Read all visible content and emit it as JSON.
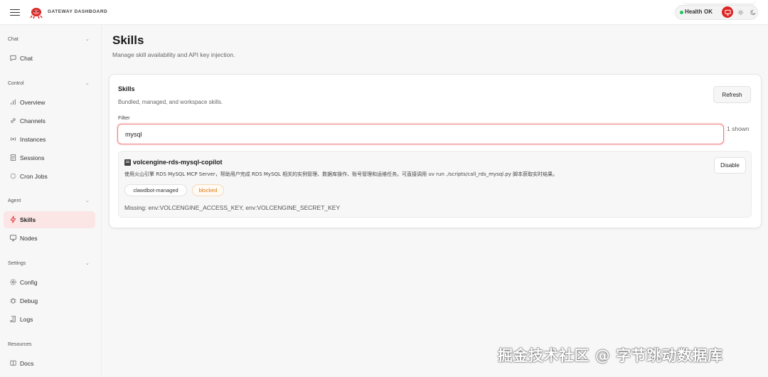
{
  "header": {
    "brand": "GATEWAY DASHBOARD",
    "health_label": "Health",
    "health_value": "OK",
    "health_color": "#22c55e",
    "theme_active_color": "#dc2626"
  },
  "sidebar": {
    "sections": [
      {
        "title": "Chat",
        "items": [
          {
            "label": "Chat",
            "icon": "message-icon"
          }
        ]
      },
      {
        "title": "Control",
        "items": [
          {
            "label": "Overview",
            "icon": "bar-chart-icon"
          },
          {
            "label": "Channels",
            "icon": "link-icon"
          },
          {
            "label": "Instances",
            "icon": "radio-icon"
          },
          {
            "label": "Sessions",
            "icon": "document-icon"
          },
          {
            "label": "Cron Jobs",
            "icon": "loader-icon"
          }
        ]
      },
      {
        "title": "Agent",
        "items": [
          {
            "label": "Skills",
            "icon": "lightning-icon",
            "active": true
          },
          {
            "label": "Nodes",
            "icon": "monitor-icon"
          }
        ]
      },
      {
        "title": "Settings",
        "items": [
          {
            "label": "Config",
            "icon": "gear-icon"
          },
          {
            "label": "Debug",
            "icon": "bug-icon"
          },
          {
            "label": "Logs",
            "icon": "scroll-icon"
          }
        ]
      },
      {
        "title": "Resources",
        "items": [
          {
            "label": "Docs",
            "icon": "book-icon"
          }
        ]
      }
    ]
  },
  "main": {
    "title": "Skills",
    "subtitle": "Manage skill availability and API key injection.",
    "card": {
      "title": "Skills",
      "subtitle": "Bundled, managed, and workspace skills.",
      "refresh_label": "Refresh",
      "filter_label": "Filter",
      "filter_value": "mysql",
      "shown_count": "1 shown",
      "skill": {
        "name": "volcengine-rds-mysql-copilot",
        "description": "使用火山引擎 RDS MySQL MCP Server，帮助用户完成 RDS MySQL 相关的实例管理、数据库操作、账号管理和运维任务。可直接调用 uv run ./scripts/call_rds_mysql.py 脚本获取实时结果。",
        "source_chip": "clawdbot-managed",
        "status_chip": "blocked",
        "missing": "Missing: env:VOLCENGINE_ACCESS_KEY, env:VOLCENGINE_SECRET_KEY",
        "disable_label": "Disable"
      }
    }
  },
  "watermark": "掘金技术社区 @ 字节跳动数据库"
}
